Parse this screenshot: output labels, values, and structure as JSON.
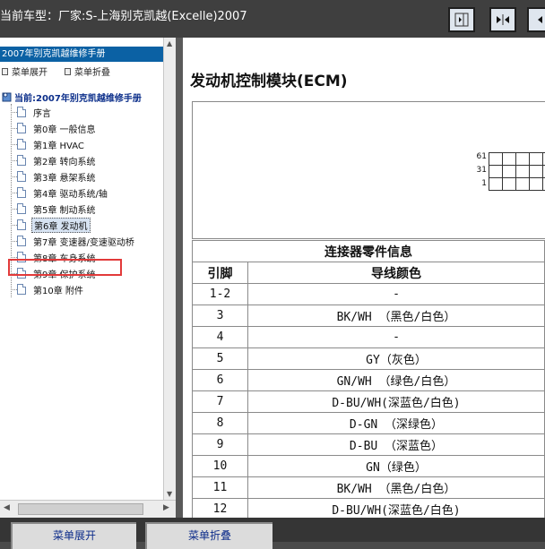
{
  "header": {
    "title": "当前车型：厂家:S-上海别克凯越(Excelle)2007",
    "buttons": [
      "panel-right-icon",
      "collapse-horizontal-icon",
      "expand-icon"
    ]
  },
  "sidebar": {
    "tab_label": "2007年别克凯越维修手册",
    "expand_label": "菜单展开",
    "collapse_label": "菜单折叠",
    "root_label": "当前:2007年别克凯越维修手册",
    "items": [
      {
        "label": "序言"
      },
      {
        "label": "第0章 一般信息"
      },
      {
        "label": "第1章 HVAC"
      },
      {
        "label": "第2章 转向系统"
      },
      {
        "label": "第3章 悬架系统"
      },
      {
        "label": "第4章 驱动系统/轴"
      },
      {
        "label": "第5章 制动系统"
      },
      {
        "label": "第6章 发动机",
        "selected": true
      },
      {
        "label": "第7章 变速器/变速驱动桥"
      },
      {
        "label": "第8章 车身系统"
      },
      {
        "label": "第9章 保护系统"
      },
      {
        "label": "第10章 附件"
      }
    ]
  },
  "content": {
    "title": "发动机控制模块(ECM)",
    "pin_labels": [
      "61",
      "31",
      "1"
    ],
    "table": {
      "caption": "连接器零件信息",
      "headers": [
        "引脚",
        "导线颜色"
      ],
      "rows": [
        [
          "1-2",
          "-"
        ],
        [
          "3",
          "BK/WH （黑色/白色）"
        ],
        [
          "4",
          "-"
        ],
        [
          "5",
          "GY（灰色）"
        ],
        [
          "6",
          "GN/WH （绿色/白色）"
        ],
        [
          "7",
          "D-BU/WH(深蓝色/白色)"
        ],
        [
          "8",
          "D-GN （深绿色）"
        ],
        [
          "9",
          "D-BU （深蓝色）"
        ],
        [
          "10",
          "GN（绿色）"
        ],
        [
          "11",
          "BK/WH （黑色/白色）"
        ],
        [
          "12",
          "D-BU/WH(深蓝色/白色)"
        ]
      ]
    }
  },
  "footer": {
    "expand_label": "菜单展开",
    "collapse_label": "菜单折叠"
  }
}
